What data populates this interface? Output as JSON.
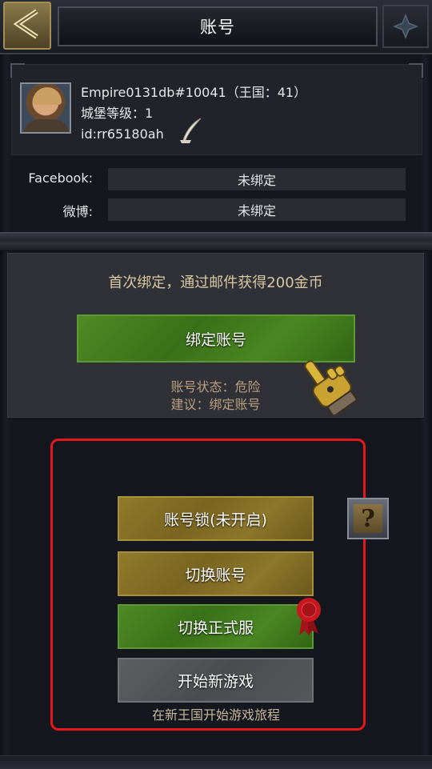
{
  "header": {
    "title": "账号"
  },
  "profile": {
    "name_line": "Empire0131db#10041（王国：41）",
    "castle_line": "城堡等级：1",
    "id_line": "id:rr65180ah"
  },
  "bindings": [
    {
      "label": "Facebook:",
      "value": "未绑定"
    },
    {
      "label": "微博:",
      "value": "未绑定"
    }
  ],
  "bind_panel": {
    "tip": "首次绑定，通过邮件获得200金币",
    "bind_button": "绑定账号",
    "status": "账号状态：危险",
    "advice": "建议：绑定账号"
  },
  "actions": {
    "account_lock": "账号锁(未开启)",
    "switch_account": "切换账号",
    "switch_server": "切换正式服",
    "new_game": "开始新游戏",
    "new_game_caption": "在新王国开始游戏旅程",
    "help_glyph": "?"
  },
  "icons": [
    "back-arrow-icon",
    "ornament-icon",
    "quill-icon",
    "gauntlet-pointer-icon",
    "help-icon",
    "wax-seal-icon"
  ],
  "colors": {
    "alert_frame": "#e5171b",
    "green_button": "#3a7019",
    "gold_button": "#7a6520",
    "gray_button": "#4a4c50"
  }
}
